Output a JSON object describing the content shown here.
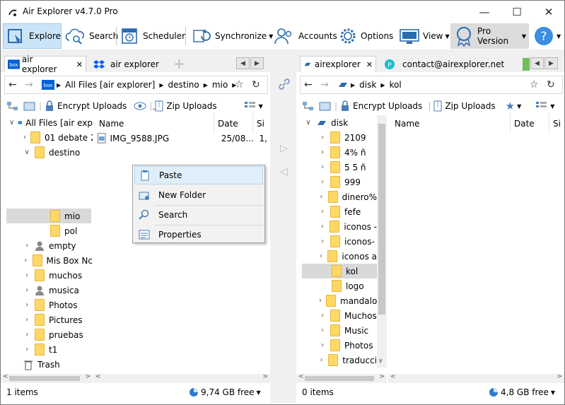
{
  "window": {
    "title": "Air Explorer v4.7.0 Pro"
  },
  "toolbar": {
    "explore": "Explore",
    "search": "Search",
    "scheduler": "Scheduler",
    "synchronize": "Synchronize",
    "accounts": "Accounts",
    "options": "Options",
    "view": "View",
    "pro": "Pro Version"
  },
  "left": {
    "tabs": [
      {
        "label": "air explorer"
      },
      {
        "label": "air explorer"
      }
    ],
    "breadcrumb": [
      "All Files [air explorer]",
      "destino",
      "mio"
    ],
    "options": {
      "encrypt": "Encrypt Uploads",
      "zip": "Zip Uploads"
    },
    "tree": [
      {
        "label": "All Files [air exp"
      },
      {
        "label": "01 debate 2"
      },
      {
        "label": "destino"
      },
      {
        "label": "mio"
      },
      {
        "label": "pol"
      },
      {
        "label": "empty"
      },
      {
        "label": "Mis Box Nc"
      },
      {
        "label": "muchos"
      },
      {
        "label": "musica"
      },
      {
        "label": "Photos"
      },
      {
        "label": "Pictures"
      },
      {
        "label": "pruebas"
      },
      {
        "label": "t1"
      },
      {
        "label": "Trash"
      }
    ],
    "columns": {
      "name": "Name",
      "date": "Date",
      "size": "Si"
    },
    "files": [
      {
        "name": "IMG_9588.JPG",
        "date": "25/08...",
        "size": "1,"
      }
    ],
    "status": {
      "items": "1 items",
      "free": "9,74 GB free"
    }
  },
  "right": {
    "tabs": [
      {
        "label": "airexplorer"
      },
      {
        "label": "contact@airexplorer.net"
      }
    ],
    "breadcrumb": [
      "disk",
      "kol"
    ],
    "options": {
      "encrypt": "Encrypt Uploads",
      "zip": "Zip Uploads"
    },
    "tree": [
      {
        "label": "disk"
      },
      {
        "label": "2109"
      },
      {
        "label": "4% ñ"
      },
      {
        "label": "5 5 ñ"
      },
      {
        "label": "999"
      },
      {
        "label": "dinero%"
      },
      {
        "label": "fefe"
      },
      {
        "label": "iconos -"
      },
      {
        "label": "iconos-"
      },
      {
        "label": "iconos a"
      },
      {
        "label": "kol"
      },
      {
        "label": "logo"
      },
      {
        "label": "mandalo"
      },
      {
        "label": "Muchos"
      },
      {
        "label": "Music"
      },
      {
        "label": "Photos"
      },
      {
        "label": "traducci"
      }
    ],
    "columns": {
      "name": "Name",
      "date": "Date",
      "size": "Si"
    },
    "status": {
      "items": "0 items",
      "free": "4,8 GB free"
    }
  },
  "context_menu": {
    "items": [
      {
        "label": "Paste"
      },
      {
        "label": "New Folder"
      },
      {
        "label": "Search"
      },
      {
        "label": "Properties"
      }
    ]
  },
  "colors": {
    "selection": "#cce4f7",
    "folder": "#ffd866",
    "accent": "#0078d7"
  }
}
